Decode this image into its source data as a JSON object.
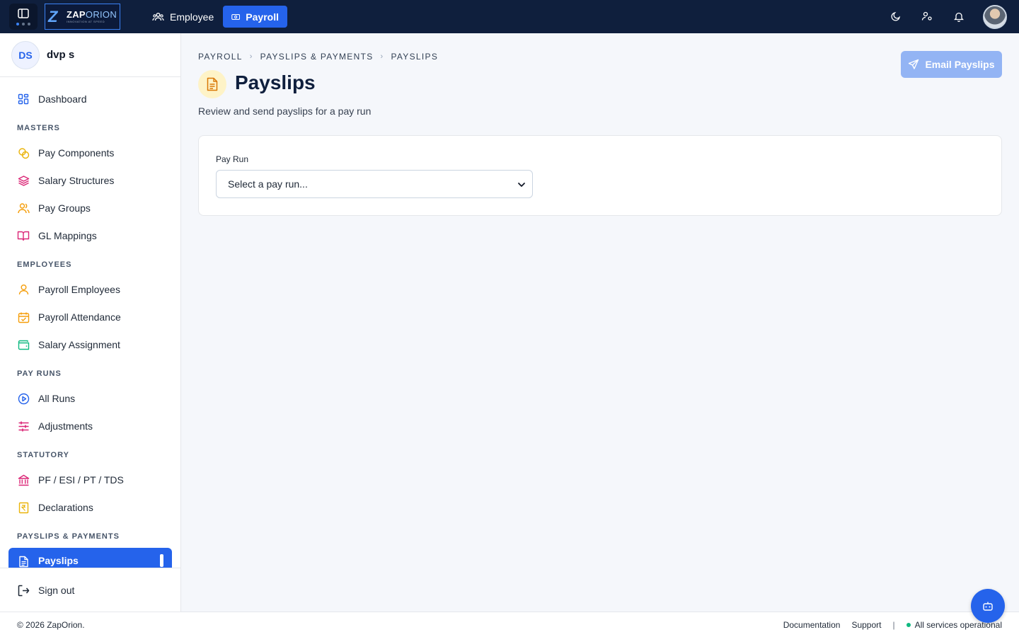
{
  "topbar": {
    "logo": {
      "word_bold": "ZAP",
      "word_light": "ORION",
      "tagline": "INNOVATION AT SPEED"
    },
    "tabs": [
      {
        "label": "Employee",
        "icon": "users-icon",
        "active": false
      },
      {
        "label": "Payroll",
        "icon": "money-icon",
        "active": true
      }
    ],
    "icons": [
      "moon-icon",
      "user-settings-icon",
      "bell-icon"
    ]
  },
  "sidebar": {
    "user": {
      "initials": "DS",
      "name": "dvp s"
    },
    "dashboard": {
      "label": "Dashboard"
    },
    "sections": [
      {
        "label": "MASTERS",
        "items": [
          {
            "label": "Pay Components",
            "icon": "coins-icon",
            "color": "#eab308"
          },
          {
            "label": "Salary Structures",
            "icon": "layers-icon",
            "color": "#db2777"
          },
          {
            "label": "Pay Groups",
            "icon": "users-icon",
            "color": "#f59e0b"
          },
          {
            "label": "GL Mappings",
            "icon": "book-icon",
            "color": "#db2777"
          }
        ]
      },
      {
        "label": "EMPLOYEES",
        "items": [
          {
            "label": "Payroll Employees",
            "icon": "user-icon",
            "color": "#f59e0b"
          },
          {
            "label": "Payroll Attendance",
            "icon": "calendar-check-icon",
            "color": "#f59e0b"
          },
          {
            "label": "Salary Assignment",
            "icon": "wallet-icon",
            "color": "#10b981"
          }
        ]
      },
      {
        "label": "PAY RUNS",
        "items": [
          {
            "label": "All Runs",
            "icon": "play-circle-icon",
            "color": "#2563eb"
          },
          {
            "label": "Adjustments",
            "icon": "sliders-icon",
            "color": "#db2777"
          }
        ]
      },
      {
        "label": "STATUTORY",
        "items": [
          {
            "label": "PF / ESI / PT / TDS",
            "icon": "bank-icon",
            "color": "#db2777"
          },
          {
            "label": "Declarations",
            "icon": "rupee-receipt-icon",
            "color": "#eab308"
          }
        ]
      },
      {
        "label": "PAYSLIPS & PAYMENTS",
        "items": [
          {
            "label": "Payslips",
            "icon": "file-text-icon",
            "color": "#ffffff",
            "active": true
          }
        ]
      }
    ],
    "signout": {
      "label": "Sign out",
      "icon": "logout-icon"
    }
  },
  "main": {
    "breadcrumb": [
      "PAYROLL",
      "PAYSLIPS & PAYMENTS",
      "PAYSLIPS"
    ],
    "title": "Payslips",
    "subtitle": "Review and send payslips for a pay run",
    "email_button": "Email Payslips",
    "pay_run": {
      "label": "Pay Run",
      "selected": "Select a pay run..."
    }
  },
  "footer": {
    "copyright": "© 2026 ZapOrion.",
    "documentation": "Documentation",
    "support": "Support",
    "status": "All services operational"
  },
  "colors": {
    "brand": "#2563eb",
    "topbar": "#0f1f3d",
    "status_ok": "#10b981"
  }
}
